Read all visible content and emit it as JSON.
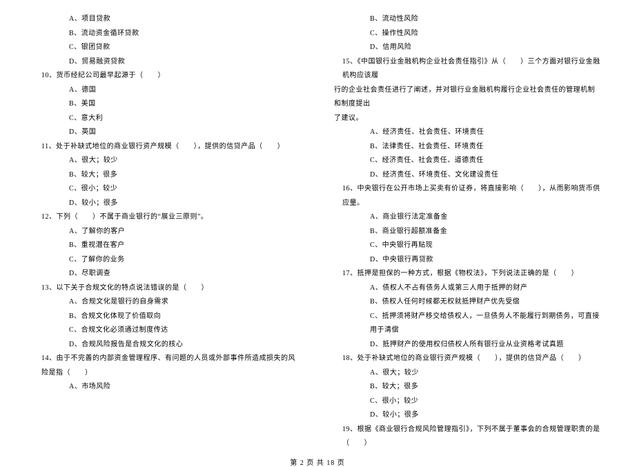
{
  "left_column": {
    "orphan_options": [
      "A、项目贷款",
      "B、流动资金循环贷款",
      "C、银团贷款",
      "D、贸易融资贷款"
    ],
    "questions": [
      {
        "stem": "10、货币经纪公司最早起源于（　　）",
        "options": [
          "A、德国",
          "B、美国",
          "C、意大利",
          "D、英国"
        ]
      },
      {
        "stem": "11、处于补缺式地位的商业银行资产规模（　　），提供的信贷产品（　　）",
        "options": [
          "A、很大；较少",
          "B、较大；很多",
          "C、很小；较少",
          "D、较小；很多"
        ]
      },
      {
        "stem": "12、下列（　　）不属于商业银行的“展业三原则”。",
        "options": [
          "A、了解你的客户",
          "B、重视潜在客户",
          "C、了解你的业务",
          "D、尽职调查"
        ]
      },
      {
        "stem": "13、以下关于合规文化的特点说法错误的是（　　）",
        "options": [
          "A、合规文化是银行的自身需求",
          "B、合规文化体现了价值取向",
          "C、合规文化必须通过制度传达",
          "D、合规风险报告是合规文化的核心"
        ]
      },
      {
        "stem": "14、由于不完善的内部资金管理程序、有问题的人员或外部事件所造成损失的风险是指（　　）",
        "options": [
          "A、市场风险"
        ]
      }
    ]
  },
  "right_column": {
    "orphan_options": [
      "B、流动性风险",
      "C、操作性风险",
      "D、信用风险"
    ],
    "questions": [
      {
        "stem_lines": [
          "15、《中国银行业金融机构企业社会责任指引》从（　　）三个方面对银行业金融机构应该履",
          "行的企业社会责任进行了阐述，并对银行业金融机构履行企业社会责任的管理机制和制度提出",
          "了建议。"
        ],
        "options": [
          "A、经济责任、社会责任、环境责任",
          "B、法律责任、社会责任、环境责任",
          "C、经济责任、社会责任、道德责任",
          "D、经济责任、环境责任、文化建设责任"
        ]
      },
      {
        "stem_lines": [
          "16、中央银行在公开市场上买卖有价证券，将直接影响（　　），从而影响货币供应量。"
        ],
        "options": [
          "A、商业银行法定准备金",
          "B、商业银行超额准备金",
          "C、中央银行再贴现",
          "D、中央银行再贷款"
        ]
      },
      {
        "stem_lines": [
          "17、抵押是担保的一种方式，根据《物权法》，下列说法正确的是（　　）"
        ],
        "options": [
          "A、债权人不占有债务人或第三人用于抵押的财产",
          "B、债权人任何时候都无权就抵押财产优先受偿",
          "C、抵押须将财产移交给债权人，一旦债务人不能履行到期债务，可直接用于清偿",
          "D、抵押财产的使用权归债权人所有银行业从业资格考试真题"
        ]
      },
      {
        "stem_lines": [
          "18、处于补缺式地位的商业银行资产规模（　　），提供的信贷产品（　　）"
        ],
        "options": [
          "A、很大；较少",
          "B、较大；很多",
          "C、很小；较少",
          "D、较小；很多"
        ]
      },
      {
        "stem_lines": [
          "19、根据《商业银行合规风险管理指引》，下列不属于董事会的合规管理职责的是（　　）"
        ],
        "options": []
      }
    ]
  },
  "footer": "第 2 页 共 18 页"
}
